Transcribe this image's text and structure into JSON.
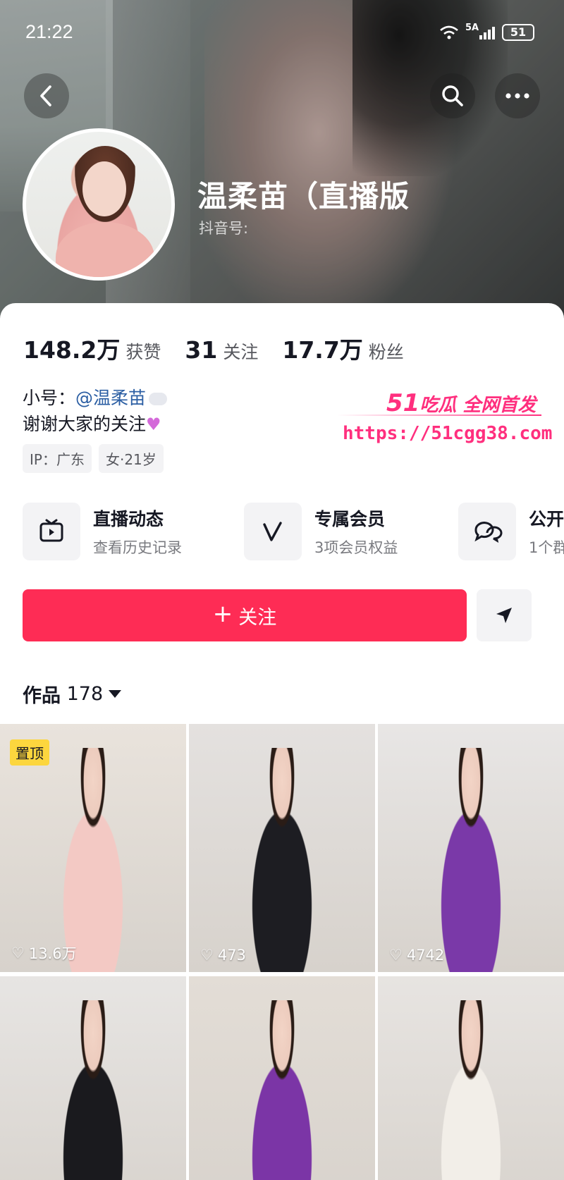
{
  "status_bar": {
    "time": "21:22",
    "network": "5A",
    "battery": "51"
  },
  "profile": {
    "name": "温柔苗（直播版",
    "douyin_id_label": "抖音号:",
    "stats": [
      {
        "value": "148.2万",
        "label": "获赞"
      },
      {
        "value": "31",
        "label": "关注"
      },
      {
        "value": "17.7万",
        "label": "粉丝"
      }
    ],
    "bio": {
      "line1_prefix": "小号：",
      "line1_link": "@温柔苗",
      "line2": "谢谢大家的关注"
    },
    "tags": [
      "IP：广东",
      "女·21岁"
    ]
  },
  "shortcuts": [
    {
      "title": "直播动态",
      "subtitle": "查看历史记录",
      "icon": "tv-icon"
    },
    {
      "title": "专属会员",
      "subtitle": "3项会员权益",
      "icon": "v-icon"
    },
    {
      "title": "公开",
      "subtitle": "1个群",
      "icon": "chat-icon"
    }
  ],
  "actions": {
    "follow_label": "关注"
  },
  "works": {
    "label": "作品",
    "count": "178",
    "items": [
      {
        "likes": "13.6万",
        "pinned_label": "置顶",
        "outfit": "#f3c9c4",
        "room": "#e9e3dc"
      },
      {
        "likes": "473",
        "outfit": "#1d1d22",
        "room": "#e4e1df"
      },
      {
        "likes": "4742",
        "outfit": "#7a39a8",
        "room": "#e8e6e5"
      },
      {
        "likes": "",
        "outfit": "#1a1a1e",
        "room": "#e7e5e3"
      },
      {
        "likes": "",
        "outfit": "#7b35a6",
        "room": "#e3ddd6"
      },
      {
        "likes": "",
        "outfit": "#f2eee8",
        "room": "#e7e4e1"
      }
    ]
  },
  "watermark": {
    "brand": "51",
    "tagline": "吃瓜 全网首发",
    "url": "https://51cgg38.com"
  },
  "colors": {
    "accent": "#fe2c55",
    "link": "#2b5ea3",
    "pin": "#fcd63e",
    "watermark": "#ff2f7e"
  }
}
